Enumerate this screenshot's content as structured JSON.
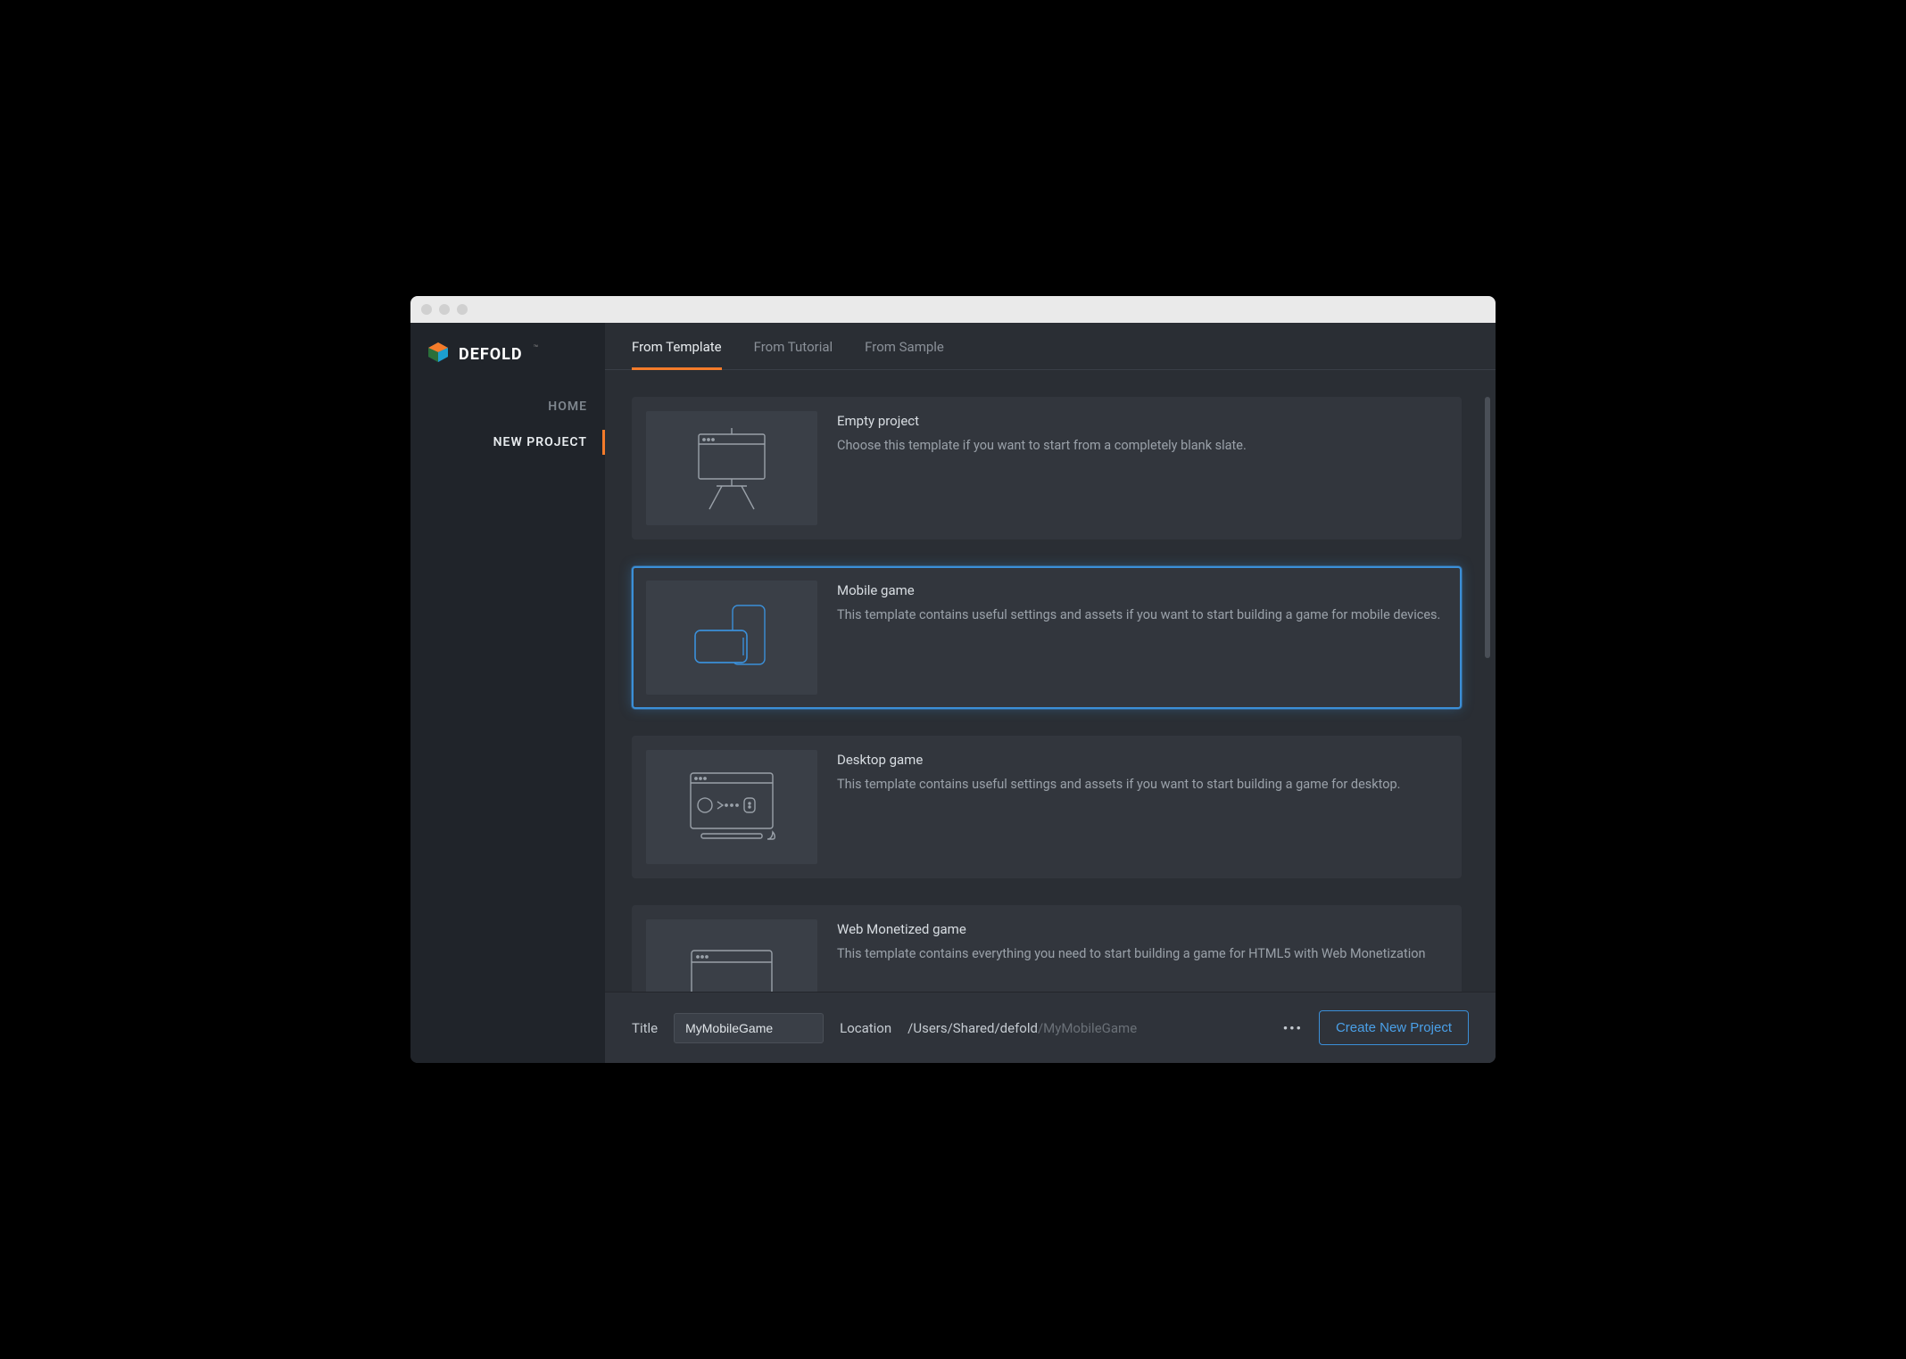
{
  "brand": {
    "name": "DEFOLD"
  },
  "sidebar": {
    "items": [
      {
        "label": "HOME",
        "active": false
      },
      {
        "label": "NEW PROJECT",
        "active": true
      }
    ]
  },
  "tabs": [
    {
      "label": "From Template",
      "active": true
    },
    {
      "label": "From Tutorial",
      "active": false
    },
    {
      "label": "From Sample",
      "active": false
    }
  ],
  "templates": [
    {
      "title": "Empty project",
      "description": "Choose this template if you want to start from a completely blank slate.",
      "icon": "easel",
      "selected": false
    },
    {
      "title": "Mobile game",
      "description": "This template contains useful settings and assets if you want to start building a game for mobile devices.",
      "icon": "devices",
      "selected": true
    },
    {
      "title": "Desktop game",
      "description": "This template contains useful settings and assets if you want to start building a game for desktop.",
      "icon": "monitor",
      "selected": false
    },
    {
      "title": "Web Monetized game",
      "description": "This template contains everything you need to start building a game for HTML5 with Web Monetization",
      "icon": "browser",
      "selected": false
    }
  ],
  "footer": {
    "title_label": "Title",
    "title_value": "MyMobileGame",
    "location_label": "Location",
    "location_path": "/Users/Shared/defold",
    "location_suffix": "/MyMobileGame",
    "create_label": "Create New Project"
  },
  "colors": {
    "accent": "#f47b2a",
    "select": "#3b8fd8"
  }
}
